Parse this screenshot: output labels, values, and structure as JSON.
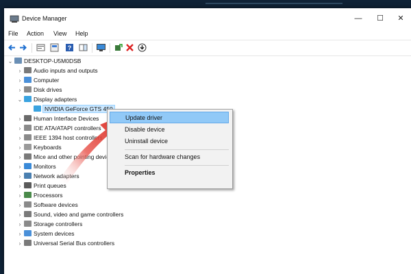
{
  "window": {
    "title": "Device Manager"
  },
  "menu": [
    "File",
    "Action",
    "View",
    "Help"
  ],
  "tree": {
    "root": "DESKTOP-U5M0DSB",
    "categories": [
      "Audio inputs and outputs",
      "Computer",
      "Disk drives",
      "Display adapters",
      "Human Interface Devices",
      "IDE ATA/ATAPI controllers",
      "IEEE 1394 host controllers",
      "Keyboards",
      "Mice and other pointing devices",
      "Monitors",
      "Network adapters",
      "Print queues",
      "Processors",
      "Software devices",
      "Sound, video and game controllers",
      "Storage controllers",
      "System devices",
      "Universal Serial Bus controllers"
    ],
    "selected_device": "NVIDIA GeForce GTS 450"
  },
  "context_menu": {
    "update_driver": "Update driver",
    "disable_device": "Disable device",
    "uninstall_device": "Uninstall device",
    "scan": "Scan for hardware changes",
    "properties": "Properties"
  },
  "colors": {
    "selection": "#cce8ff",
    "menu_highlight": "#91c9f7",
    "arrow": "#d9281e"
  },
  "icons": {
    "toolbar": [
      "back-arrow-icon",
      "forward-arrow-icon",
      "properties-icon",
      "show-hidden-icon",
      "help-icon",
      "action-pane-icon",
      "monitor-icon",
      "enable-device-icon",
      "uninstall-x-icon",
      "update-driver-icon"
    ]
  }
}
